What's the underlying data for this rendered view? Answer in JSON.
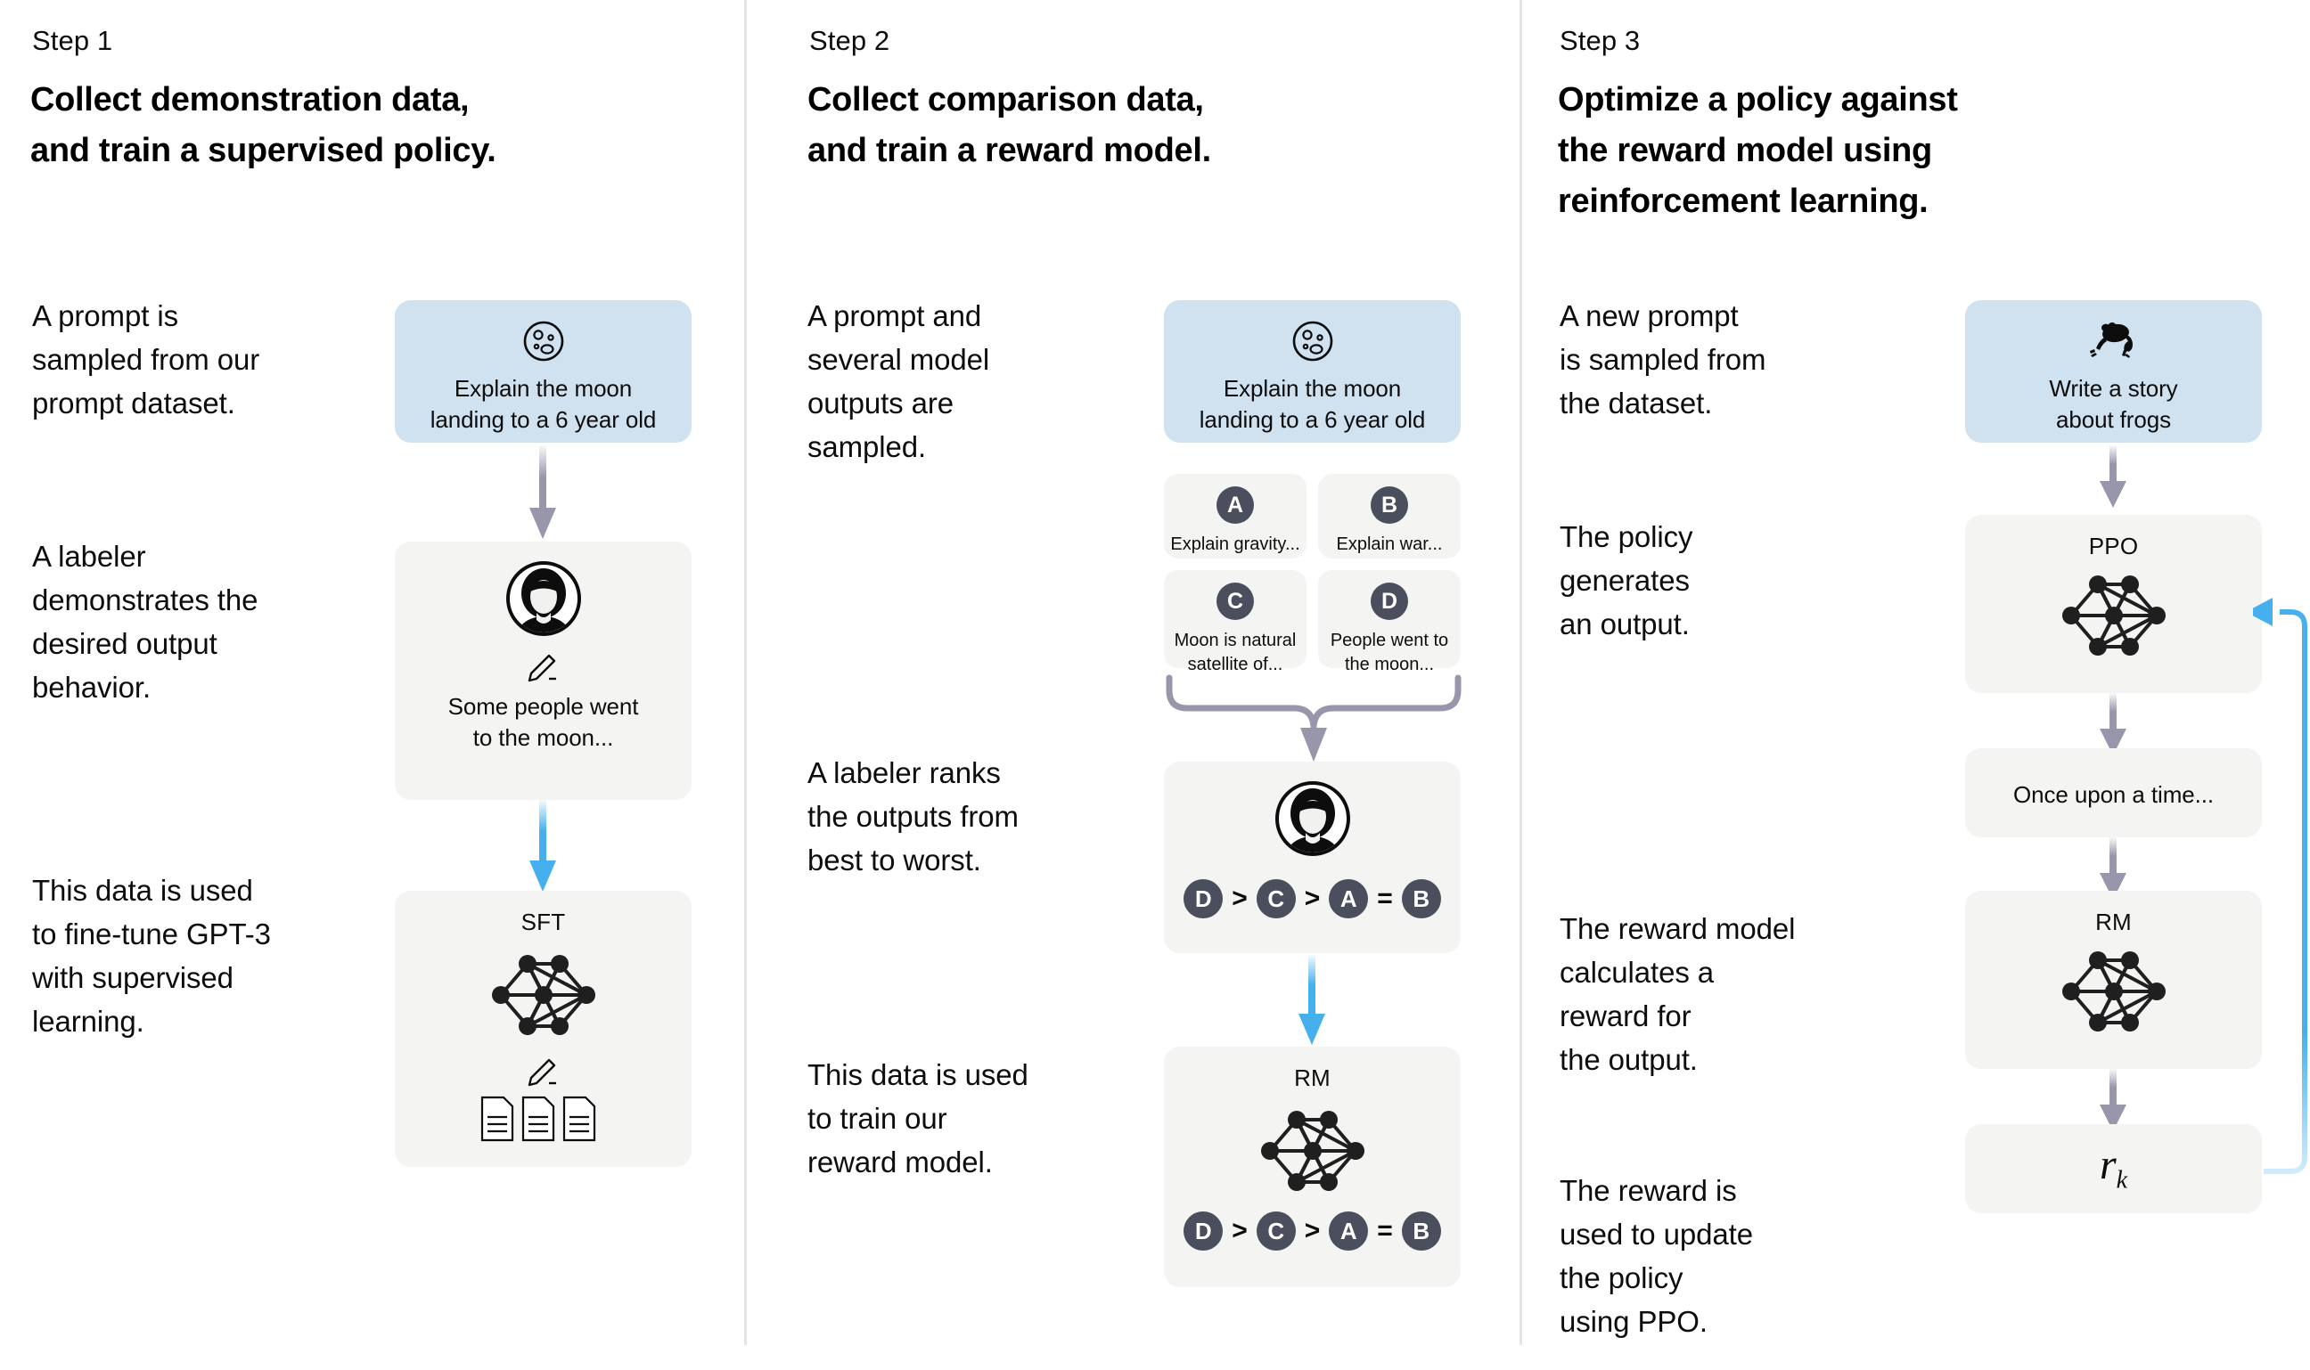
{
  "steps": [
    {
      "label": "Step 1",
      "title": "Collect demonstration data,\nand train a supervised policy.",
      "paragraphs": [
        "A prompt is\nsampled from our\nprompt dataset.",
        "A labeler\ndemonstrates the\ndesired output\nbehavior.",
        "This data is used\nto fine-tune GPT-3\nwith supervised\nlearning."
      ],
      "nodes": {
        "prompt": {
          "text": "Explain the moon\nlanding to a 6 year old",
          "icon": "moon-icon"
        },
        "labeler": {
          "text": "Some people went\nto the moon...",
          "icon": "person-avatar-icon",
          "tool_icon": "pencil-icon"
        },
        "model": {
          "title": "SFT",
          "icon": "neural-network-icon",
          "tool_icon": "pencil-icon",
          "docs_icon": "documents-icon"
        }
      }
    },
    {
      "label": "Step 2",
      "title": "Collect comparison data,\nand train a reward model.",
      "paragraphs": [
        "A prompt and\nseveral model\noutputs are\nsampled.",
        "A labeler ranks\nthe outputs from\nbest to worst.",
        "This data is used\nto train our\nreward model."
      ],
      "nodes": {
        "prompt": {
          "text": "Explain the moon\nlanding to a 6 year old",
          "icon": "moon-icon"
        },
        "outputs": [
          {
            "badge": "A",
            "text": "Explain gravity..."
          },
          {
            "badge": "B",
            "text": "Explain war..."
          },
          {
            "badge": "C",
            "text": "Moon is natural\nsatellite of..."
          },
          {
            "badge": "D",
            "text": "People went to\nthe moon..."
          }
        ],
        "ranking": [
          "D",
          ">",
          "C",
          ">",
          "A",
          "=",
          "B"
        ],
        "labeler": {
          "icon": "person-avatar-icon"
        },
        "model": {
          "title": "RM",
          "icon": "neural-network-icon"
        }
      }
    },
    {
      "label": "Step 3",
      "title": "Optimize a policy against\nthe reward model using\nreinforcement learning.",
      "paragraphs": [
        "A new prompt\nis sampled from\nthe dataset.",
        "The policy\ngenerates\nan output.",
        "The reward model\ncalculates a\nreward for\nthe output.",
        "The reward is\nused to update\nthe policy\nusing PPO."
      ],
      "nodes": {
        "prompt": {
          "text": "Write a story\nabout frogs",
          "icon": "frog-icon"
        },
        "policy": {
          "title": "PPO",
          "icon": "neural-network-icon"
        },
        "output": {
          "text": "Once upon a time..."
        },
        "reward_model": {
          "title": "RM",
          "icon": "neural-network-icon"
        },
        "reward": {
          "text": "r",
          "subscript": "k"
        }
      }
    }
  ],
  "colors": {
    "prompt_box": "#d0e1ef",
    "node_box": "#f4f4f2",
    "arrow_gray": "#9896ab",
    "arrow_blue": "#45b0ed",
    "badge": "#4a4e5d",
    "divider": "#e4e5e7",
    "text": "#0d0d0d"
  }
}
